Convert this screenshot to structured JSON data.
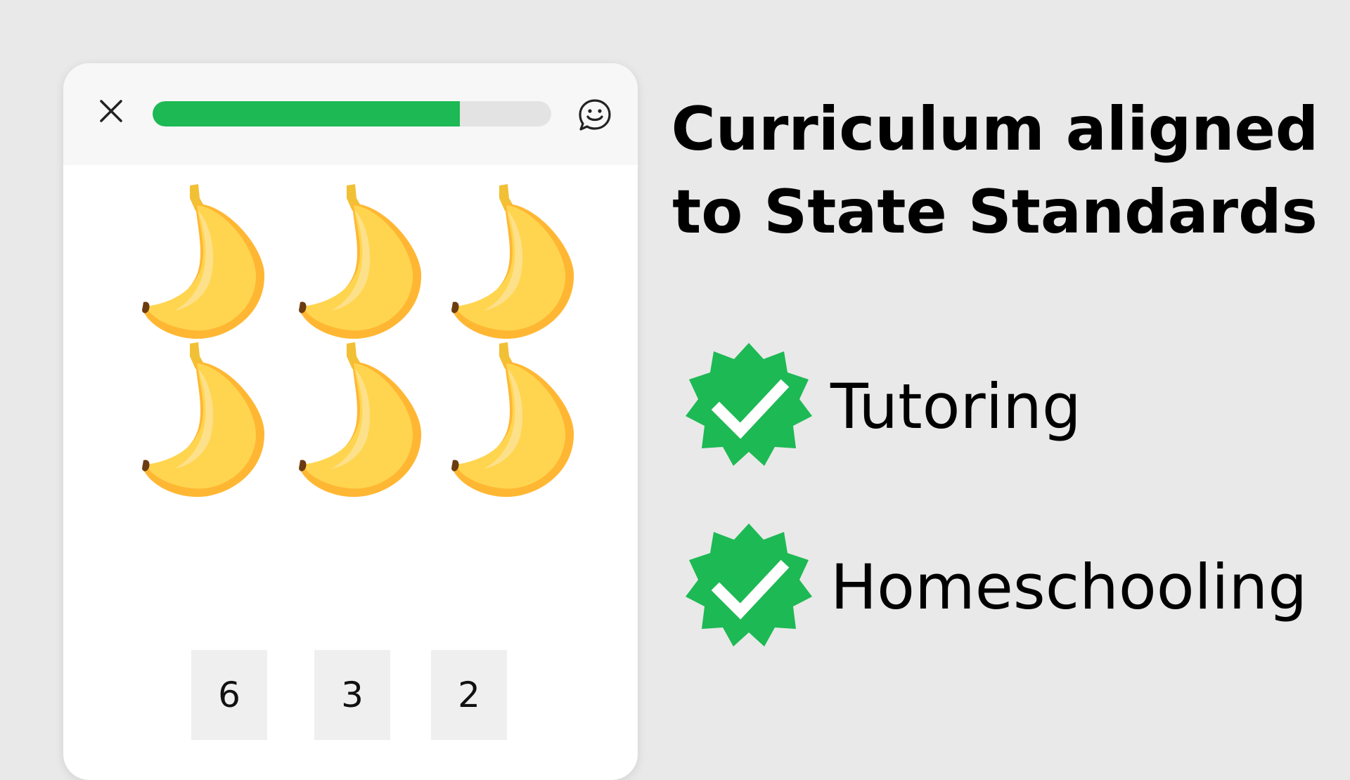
{
  "lesson": {
    "close_icon": "close-icon",
    "chat_icon": "chat-smiley-icon",
    "progress": 0.77,
    "progress_color": "#1db954",
    "picture_item": "banana",
    "picture_count": 6,
    "answers": [
      "6",
      "3",
      "2"
    ]
  },
  "headline": {
    "line1": "Curriculum aligned",
    "line2": "to State Standards"
  },
  "features": [
    {
      "icon": "check-badge-icon",
      "label": "Tutoring"
    },
    {
      "icon": "check-badge-icon",
      "label": "Homeschooling"
    }
  ],
  "colors": {
    "background": "#e9e9e9",
    "accent_green": "#1db954",
    "banana_yellow": "#ffd54f"
  }
}
